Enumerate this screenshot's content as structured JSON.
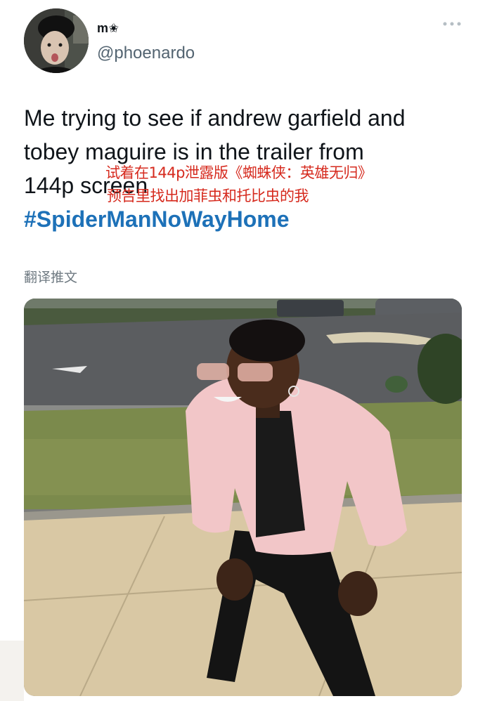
{
  "user": {
    "display_name": "m✬",
    "handle": "@phoenardo",
    "avatar_icon": "avatar-photo-icon",
    "more_icon": "more-options-icon"
  },
  "tweet": {
    "lines": [
      "Me trying to see if andrew garfield and",
      "tobey maguire is in the trailer from",
      "144p screen"
    ],
    "hashtag": "#SpiderManNoWayHome",
    "overlay_caption_line1": "试着在144p泄露版《蜘蛛侠：英雄无归》",
    "overlay_caption_line2": "预告里找出加菲虫和托比虫的我",
    "translate_label": "翻译推文"
  },
  "media": {
    "description_icon": "meme-photo-image"
  },
  "colors": {
    "text": "#0f1419",
    "secondary": "#536471",
    "hashtag": "#1d71b8",
    "overlay_red": "#d62a1e",
    "jacket_pink": "#f2c6c8"
  }
}
